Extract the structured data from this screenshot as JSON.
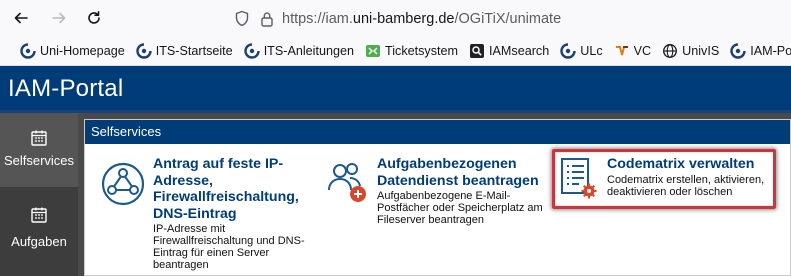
{
  "browser": {
    "url_prefix": "https://iam.",
    "url_host": "uni-bamberg.de",
    "url_path": "/OGiTiX/unimate"
  },
  "bookmarks": [
    {
      "label": "Uni-Homepage",
      "icon": "uni-logo-icon"
    },
    {
      "label": "ITS-Startseite",
      "icon": "uni-logo-icon"
    },
    {
      "label": "ITS-Anleitungen",
      "icon": "uni-logo-icon"
    },
    {
      "label": "Ticketsystem",
      "icon": "ticket-icon"
    },
    {
      "label": "IAMsearch",
      "icon": "search-icon"
    },
    {
      "label": "ULc",
      "icon": "uni-logo-icon"
    },
    {
      "label": "VC",
      "icon": "vc-icon"
    },
    {
      "label": "UnivIS",
      "icon": "globe-icon"
    },
    {
      "label": "IAM-Portal",
      "icon": "uni-logo-icon"
    }
  ],
  "portal": {
    "title": "IAM-Portal"
  },
  "sidebar": {
    "items": [
      {
        "label": "Selfservices",
        "icon": "calendar-icon",
        "active": true
      },
      {
        "label": "Aufgaben",
        "icon": "calendar-icon",
        "active": false
      }
    ]
  },
  "section": {
    "title": "Selfservices"
  },
  "tiles": [
    {
      "title": "Antrag auf feste IP-Adresse, Firewallfreischaltung, DNS-Eintrag",
      "description": "IP-Adresse mit Firewallfreischaltung und DNS-Eintrag für einen Server beantragen",
      "icon": "network-icon"
    },
    {
      "title": "Aufgabenbezogenen Datendienst beantragen",
      "description": "Aufgabenbezogene E-Mail-Postfächer oder Speicherplatz am Fileserver beantragen",
      "icon": "user-add-icon"
    },
    {
      "title": "Codematrix verwalten",
      "description": "Codematrix erstellen, aktivieren, deaktivieren oder löschen",
      "icon": "list-settings-icon"
    }
  ],
  "colors": {
    "brand": "#003c78",
    "highlight": "#c8373e",
    "sidebar": "#3d3d3d"
  }
}
